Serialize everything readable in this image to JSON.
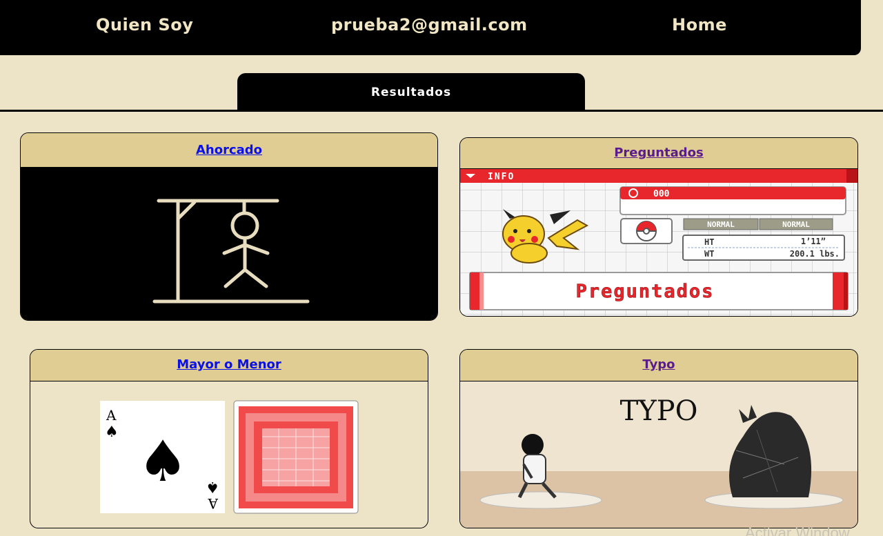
{
  "nav": {
    "about": "Quien Soy",
    "email": "prueba2@gmail.com",
    "home": "Home"
  },
  "tabs": {
    "results": "Resultados"
  },
  "cards": {
    "ahorcado": {
      "title": "Ahorcado"
    },
    "preguntados": {
      "title": "Preguntados",
      "info": "INFO",
      "number": "000",
      "type1": "NORMAL",
      "type2": "NORMAL",
      "ht_label": "HT",
      "ht_value": "1’11”",
      "wt_label": "WT",
      "wt_value": "200.1 lbs.",
      "banner": "Preguntados"
    },
    "mayor": {
      "title": "Mayor o Menor",
      "card_rank": "A",
      "card_suit": "♠"
    },
    "typo": {
      "title": "Typo",
      "logo": "TYPO"
    }
  },
  "overlay": {
    "watermark": "Activar Window"
  },
  "colors": {
    "bg": "#ede4c8",
    "header": "#e0cd93",
    "accent": "#e8272c"
  }
}
